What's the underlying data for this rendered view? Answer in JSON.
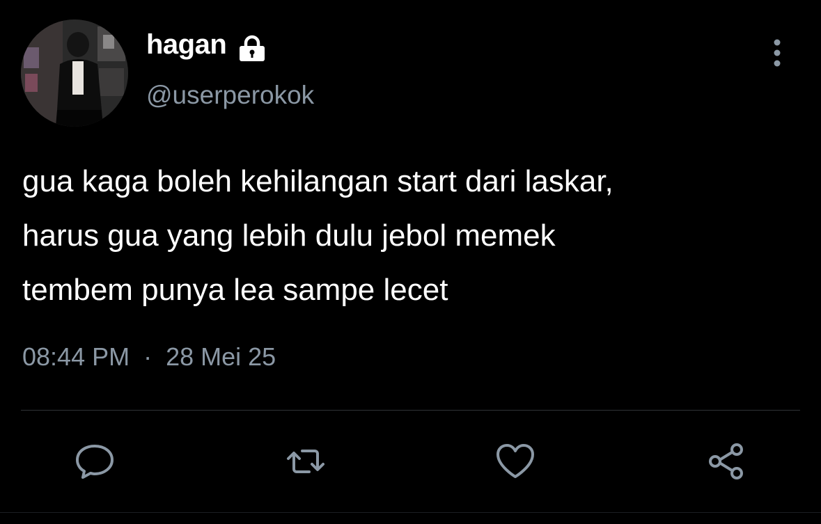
{
  "tweet": {
    "author": {
      "display_name": "hagan",
      "handle": "@userperokok",
      "protected_icon": "lock-icon",
      "avatar_icon": "profile-photo"
    },
    "text": "gua kaga boleh kehilangan start dari laskar,\nharus gua yang lebih dulu jebol memek\ntembem punya lea sampe lecet",
    "time": "08:44 PM",
    "separator": "·",
    "date": "28 Mei 25",
    "more_icon": "more-vertical-icon"
  },
  "actions": [
    {
      "icon": "reply-icon"
    },
    {
      "icon": "retweet-icon"
    },
    {
      "icon": "like-icon"
    },
    {
      "icon": "share-icon"
    }
  ],
  "colors": {
    "background": "#000000",
    "text_primary": "#ffffff",
    "text_secondary": "#8b98a5",
    "divider": "#2f3336"
  }
}
